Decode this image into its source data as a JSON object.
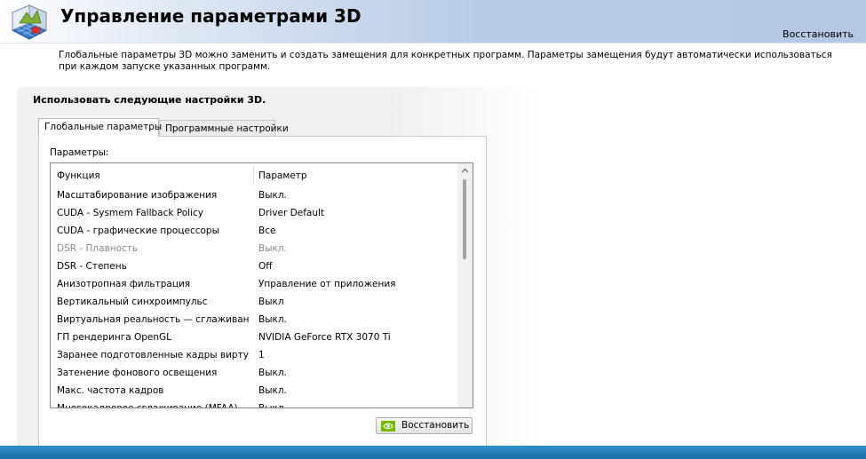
{
  "header": {
    "title": "Управление параметрами 3D",
    "restore_label": "Восстановить",
    "app_icon": "nvidia-3d-settings-icon"
  },
  "description": "Глобальные параметры 3D можно заменить и создать замещения для конкретных программ. Параметры замещения будут автоматически использоваться при каждом запуске указанных программ.",
  "panel": {
    "heading": "Использовать следующие настройки 3D.",
    "tabs": [
      {
        "label": "Глобальные параметры",
        "active": true
      },
      {
        "label": "Программные настройки",
        "active": false
      }
    ],
    "params_label": "Параметры:",
    "columns": {
      "function": "Функция",
      "parameter": "Параметр"
    },
    "rows": [
      {
        "function": "Масштабирование изображения",
        "value": "Выкл."
      },
      {
        "function": "CUDA - Sysmem Fallback Policy",
        "value": "Driver Default"
      },
      {
        "function": "CUDA - графические процессоры",
        "value": "Все"
      },
      {
        "function": "DSR - Плавность",
        "value": "Выкл.",
        "disabled": true
      },
      {
        "function": "DSR - Степень",
        "value": "Off"
      },
      {
        "function": "Анизотропная фильтрация",
        "value": "Управление от приложения"
      },
      {
        "function": "Вертикальный синхроимпульс",
        "value": "Выкл"
      },
      {
        "function": "Виртуальная реальность — сглаживан...",
        "value": "Выкл."
      },
      {
        "function": "ГП рендеринга OpenGL",
        "value": "NVIDIA GeForce RTX 3070 Ti"
      },
      {
        "function": "Заранее подготовленные кадры вирту...",
        "value": "1"
      },
      {
        "function": "Затенение фонового освещения",
        "value": "Выкл."
      },
      {
        "function": "Макс. частота кадров",
        "value": "Выкл."
      },
      {
        "function": "Многокадровое сглаживание (MFAA)",
        "value": "Выкл."
      }
    ],
    "restore_button": "Восстановить",
    "restore_button_icon": "nvidia-logo-icon"
  },
  "colors": {
    "header_gradient_end": "#b4c8e4",
    "taskbar": "#2f8fc8",
    "disabled_text": "#8a8a8a"
  }
}
